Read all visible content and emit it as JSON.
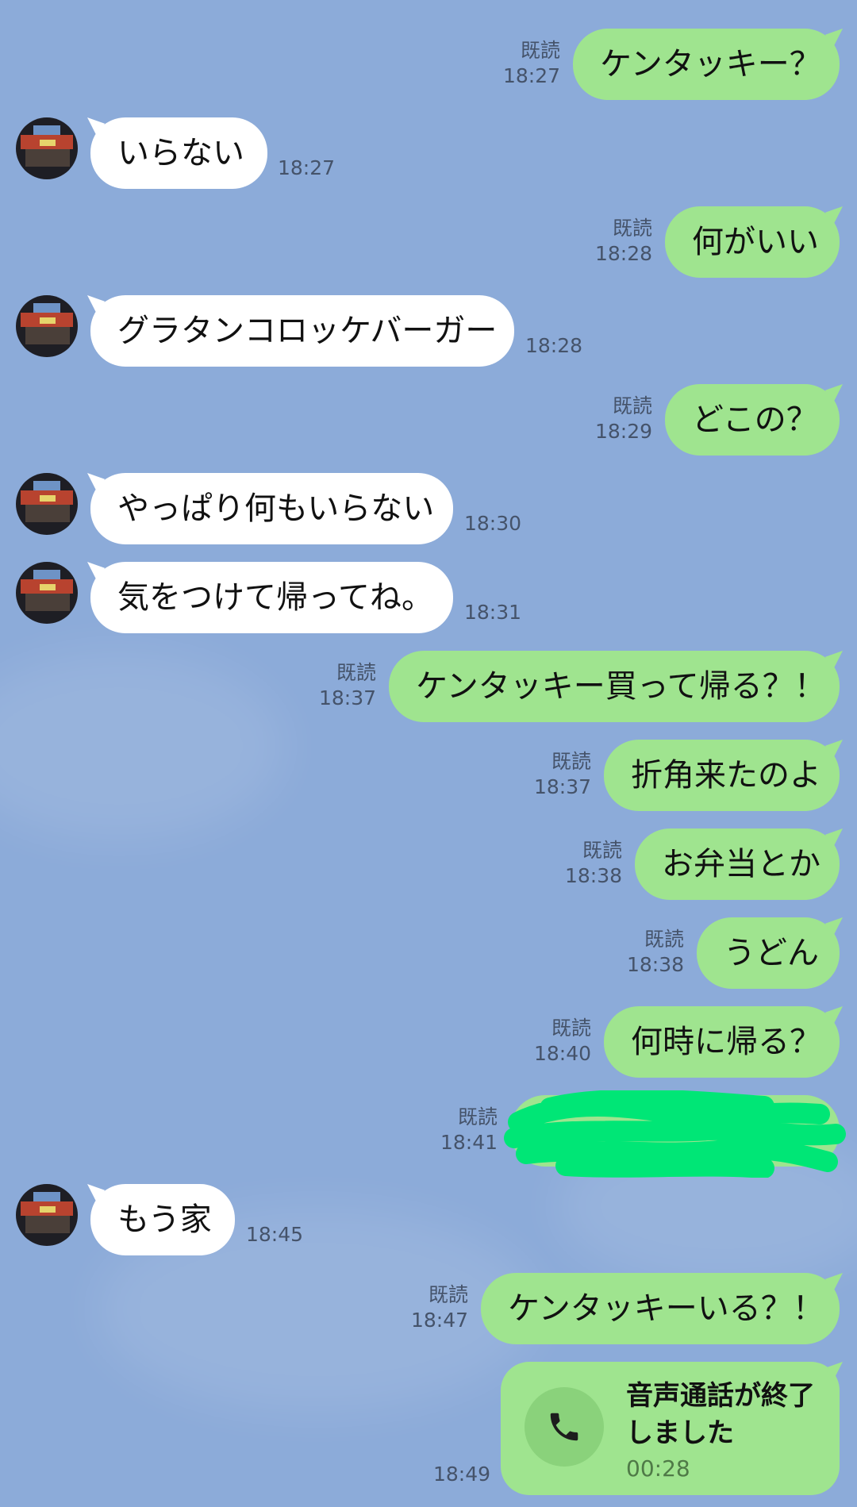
{
  "messages": [
    {
      "side": "out",
      "text": "ケンタッキー？",
      "status": "既読",
      "time": "18:27"
    },
    {
      "side": "in",
      "text": "いらない",
      "time": "18:27"
    },
    {
      "side": "out",
      "text": "何がいい",
      "status": "既読",
      "time": "18:28"
    },
    {
      "side": "in",
      "text": "グラタンコロッケバーガー",
      "time": "18:28"
    },
    {
      "side": "out",
      "text": "どこの？",
      "status": "既読",
      "time": "18:29"
    },
    {
      "side": "in",
      "text": "やっぱり何もいらない",
      "time": "18:30"
    },
    {
      "side": "in",
      "text": "気をつけて帰ってね。",
      "time": "18:31"
    },
    {
      "side": "out",
      "text": "ケンタッキー買って帰る？！",
      "status": "既読",
      "time": "18:37"
    },
    {
      "side": "out",
      "text": "折角来たのよ",
      "status": "既読",
      "time": "18:37"
    },
    {
      "side": "out",
      "text": "お弁当とか",
      "status": "既読",
      "time": "18:38"
    },
    {
      "side": "out",
      "text": "うどん",
      "status": "既読",
      "time": "18:38"
    },
    {
      "side": "out",
      "text": "何時に帰る？",
      "status": "既読",
      "time": "18:40"
    },
    {
      "side": "out",
      "text": "",
      "status": "既読",
      "time": "18:41",
      "redacted": true
    },
    {
      "side": "in",
      "text": "もう家",
      "time": "18:45"
    },
    {
      "side": "out",
      "text": "ケンタッキーいる？！",
      "status": "既読",
      "time": "18:47"
    }
  ],
  "call": {
    "title": "音声通話が終了しました",
    "duration": "00:28",
    "time": "18:49",
    "icon": "phone-icon"
  },
  "colors": {
    "background": "#8cabd9",
    "outgoing_bubble": "#9fe48f",
    "incoming_bubble": "#ffffff",
    "redaction": "#00e676"
  }
}
